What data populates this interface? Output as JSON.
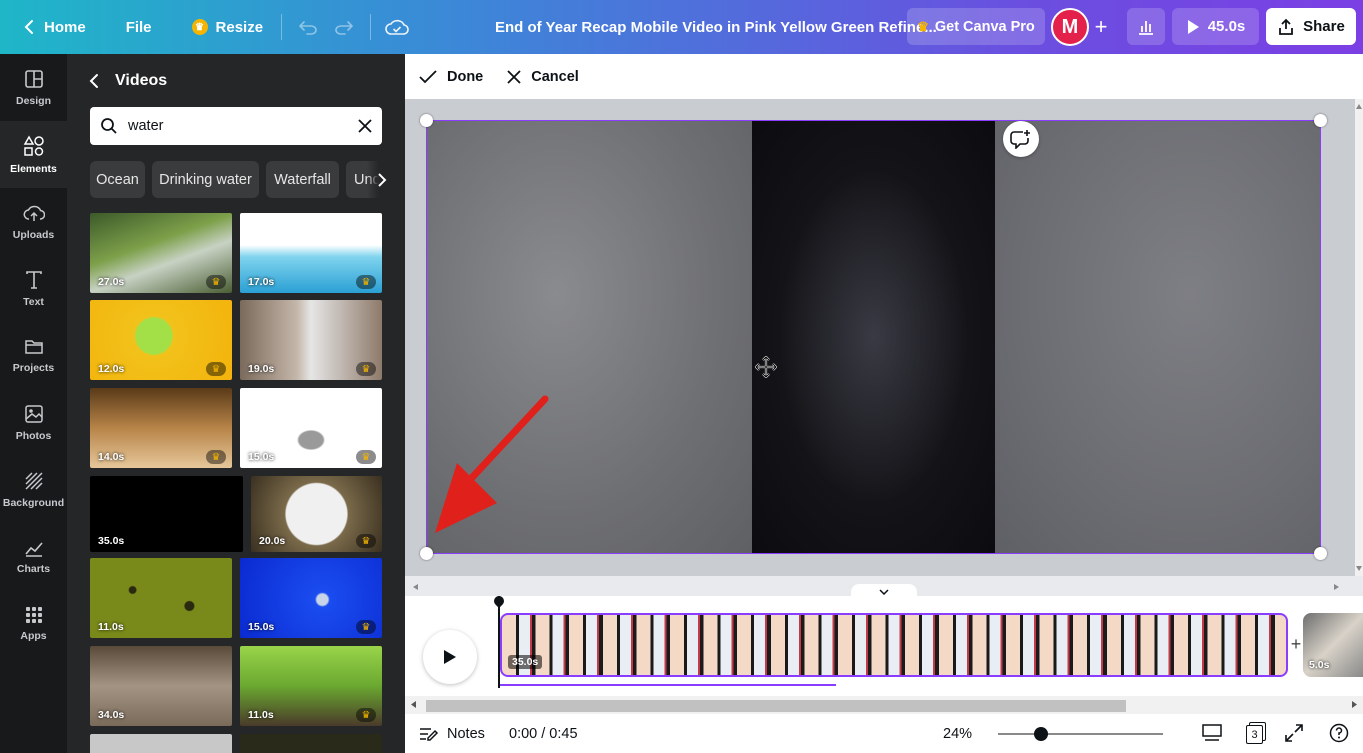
{
  "topbar": {
    "home_label": "Home",
    "file_label": "File",
    "resize_label": "Resize",
    "doc_title": "End of Year Recap Mobile Video in Pink Yellow Green Refine...",
    "getpro_label": "Get Canva Pro",
    "avatar_initial": "M",
    "present_duration": "45.0s",
    "share_label": "Share"
  },
  "rail": [
    {
      "label": "Design",
      "icon": "layout-icon"
    },
    {
      "label": "Elements",
      "icon": "shapes-icon",
      "active": true
    },
    {
      "label": "Uploads",
      "icon": "cloud-upload-icon"
    },
    {
      "label": "Text",
      "icon": "text-icon"
    },
    {
      "label": "Projects",
      "icon": "folder-icon"
    },
    {
      "label": "Photos",
      "icon": "image-icon"
    },
    {
      "label": "Background",
      "icon": "hatch-icon"
    },
    {
      "label": "Charts",
      "icon": "chart-icon"
    },
    {
      "label": "Apps",
      "icon": "grid-icon"
    }
  ],
  "panel": {
    "title": "Videos",
    "search_value": "water",
    "chips": [
      "Ocean",
      "Drinking water",
      "Waterfall",
      "Und"
    ],
    "videos": [
      {
        "duration": "27.0s",
        "pro": true
      },
      {
        "duration": "17.0s",
        "pro": true
      },
      {
        "duration": "12.0s",
        "pro": true
      },
      {
        "duration": "19.0s",
        "pro": true
      },
      {
        "duration": "14.0s",
        "pro": true
      },
      {
        "duration": "15.0s",
        "pro": true
      },
      {
        "duration": "35.0s",
        "pro": false
      },
      {
        "duration": "20.0s",
        "pro": true
      },
      {
        "duration": "11.0s",
        "pro": false
      },
      {
        "duration": "15.0s",
        "pro": true
      },
      {
        "duration": "34.0s",
        "pro": false
      },
      {
        "duration": "11.0s",
        "pro": true
      }
    ]
  },
  "editbar": {
    "done_label": "Done",
    "cancel_label": "Cancel"
  },
  "timeline": {
    "clip1_duration": "35.0s",
    "clip2_duration": "5.0s"
  },
  "footer": {
    "notes_label": "Notes",
    "time_readout": "0:00 / 0:45",
    "zoom": "24%",
    "page_count": "3"
  },
  "colors": {
    "accent": "#8b3dff",
    "annotation_arrow": "#e0201b",
    "avatar": "#e4214a",
    "crown": "#f5b400"
  }
}
